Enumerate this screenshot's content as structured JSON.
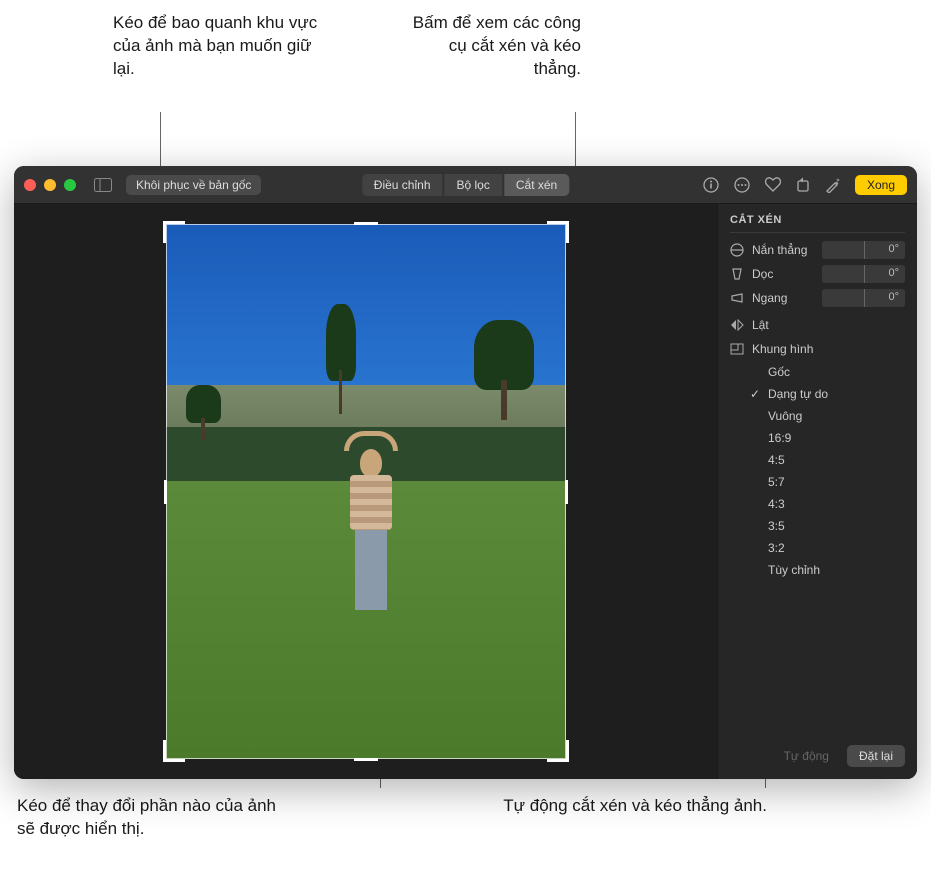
{
  "callouts": {
    "top_left": "Kéo để bao quanh khu vực của ảnh mà bạn muốn giữ lại.",
    "top_right": "Bấm để xem các công cụ cắt xén và kéo thẳng.",
    "bottom_left": "Kéo để thay đổi phần nào của ảnh sẽ được hiển thị.",
    "bottom_right": "Tự động cắt xén và kéo thẳng ảnh."
  },
  "toolbar": {
    "revert": "Khôi phục về bản gốc",
    "done": "Xong"
  },
  "tabs": {
    "adjust": "Điều chỉnh",
    "filters": "Bộ lọc",
    "crop": "Cắt xén"
  },
  "panel": {
    "title": "CẮT XÉN",
    "straighten": "Nắn thẳng",
    "vertical": "Dọc",
    "horizontal": "Ngang",
    "straighten_val": "0°",
    "vertical_val": "0°",
    "horizontal_val": "0°",
    "flip": "Lật",
    "aspect": "Khung hình",
    "aspects": {
      "original": "Gốc",
      "freeform": "Dạng tự do",
      "square": "Vuông",
      "r169": "16:9",
      "r45": "4:5",
      "r57": "5:7",
      "r43": "4:3",
      "r35": "3:5",
      "r32": "3:2",
      "custom": "Tùy chỉnh"
    },
    "auto": "Tự động",
    "reset": "Đặt lại"
  }
}
